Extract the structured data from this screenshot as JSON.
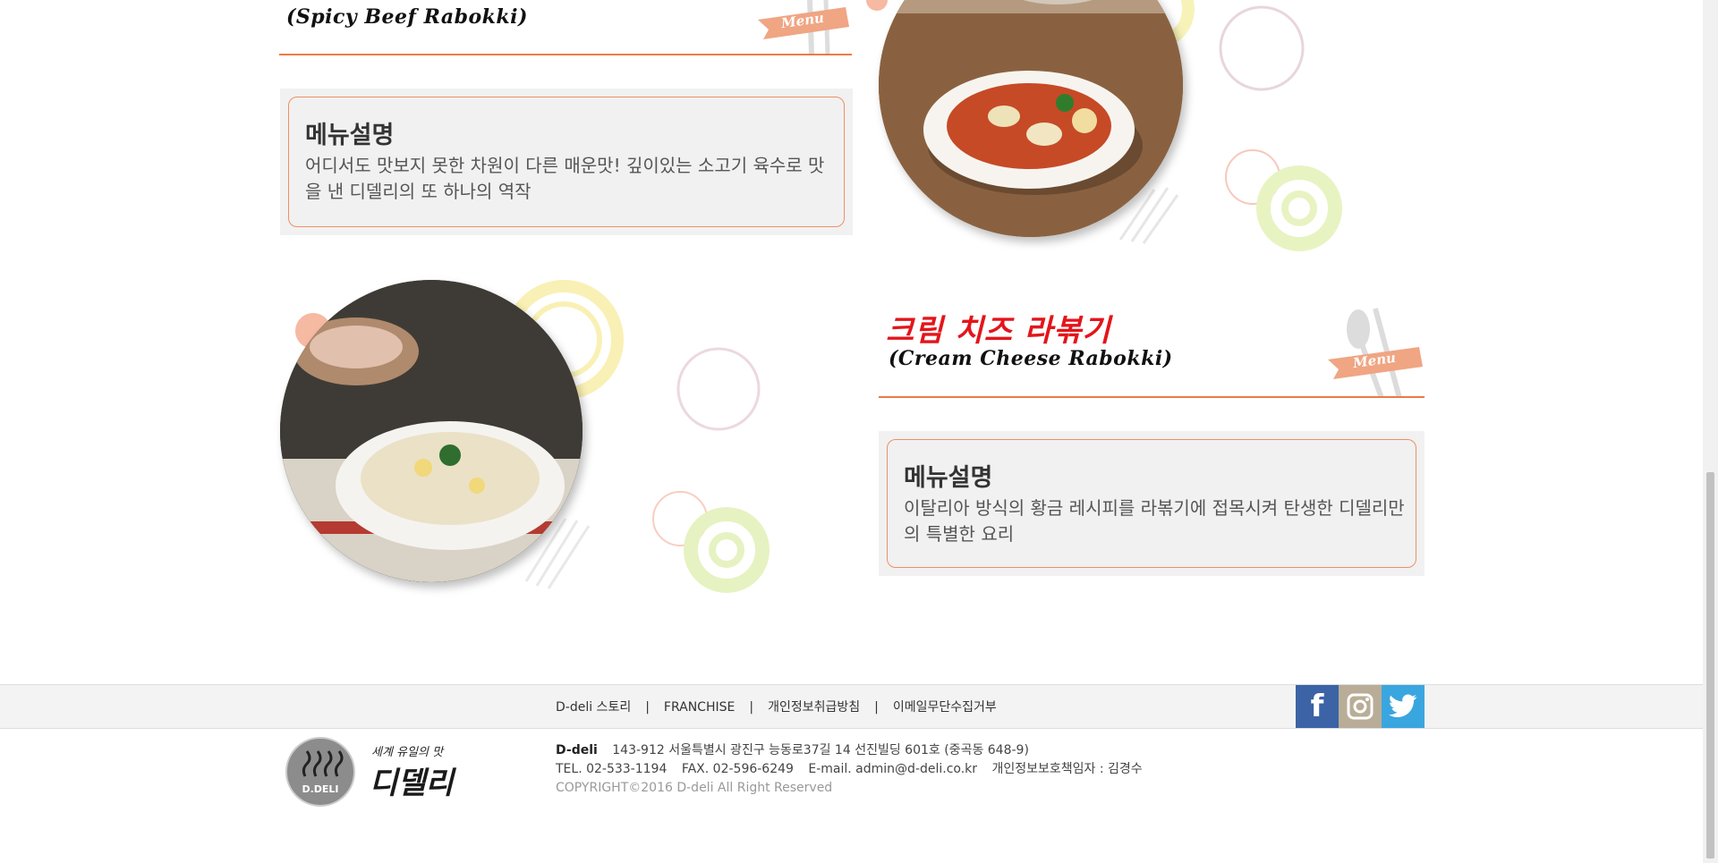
{
  "menu1": {
    "subtitle": "(Spicy Beef Rabokki)",
    "badge": "Menu",
    "desc_title": "메뉴설명",
    "desc_text": "어디서도 맛보지 못한 차원이 다른 매운맛! 깊이있는 소고기 육수로 맛을 낸 디델리의 또 하나의 역작"
  },
  "menu2": {
    "title": "크림 치즈 라볶기",
    "subtitle": "(Cream Cheese Rabokki)",
    "badge": "Menu",
    "desc_title": "메뉴설명",
    "desc_text": "이탈리아 방식의 황금 레시피를 라볶기에 접목시켜 탄생한 디델리만의 특별한 요리"
  },
  "footer": {
    "links": [
      "D-deli 스토리",
      "FRANCHISE",
      "개인정보취급방침",
      "이메일무단수집거부"
    ],
    "logo_tagline": "세계 유일의 맛",
    "logo_name": "디델리",
    "logo_badge": "D.DELI",
    "brand": "D-deli",
    "address": "143-912 서울특별시 광진구 능동로37길 14 선진빌딩 601호 (중곡동 648-9)",
    "tel": "TEL. 02-533-1194",
    "fax": "FAX. 02-596-6249",
    "email": "E-mail. admin@d-deli.co.kr",
    "privacy_officer": "개인정보보호책임자 : 김경수",
    "copyright": "COPYRIGHT©2016 D-deli All Right Reserved"
  },
  "social": {
    "facebook_color": "#3b63a6",
    "instagram_color": "#b9ad97",
    "twitter_color": "#3aa6e0"
  },
  "colors": {
    "accent": "#ec7a45",
    "title_red": "#e3151b"
  }
}
